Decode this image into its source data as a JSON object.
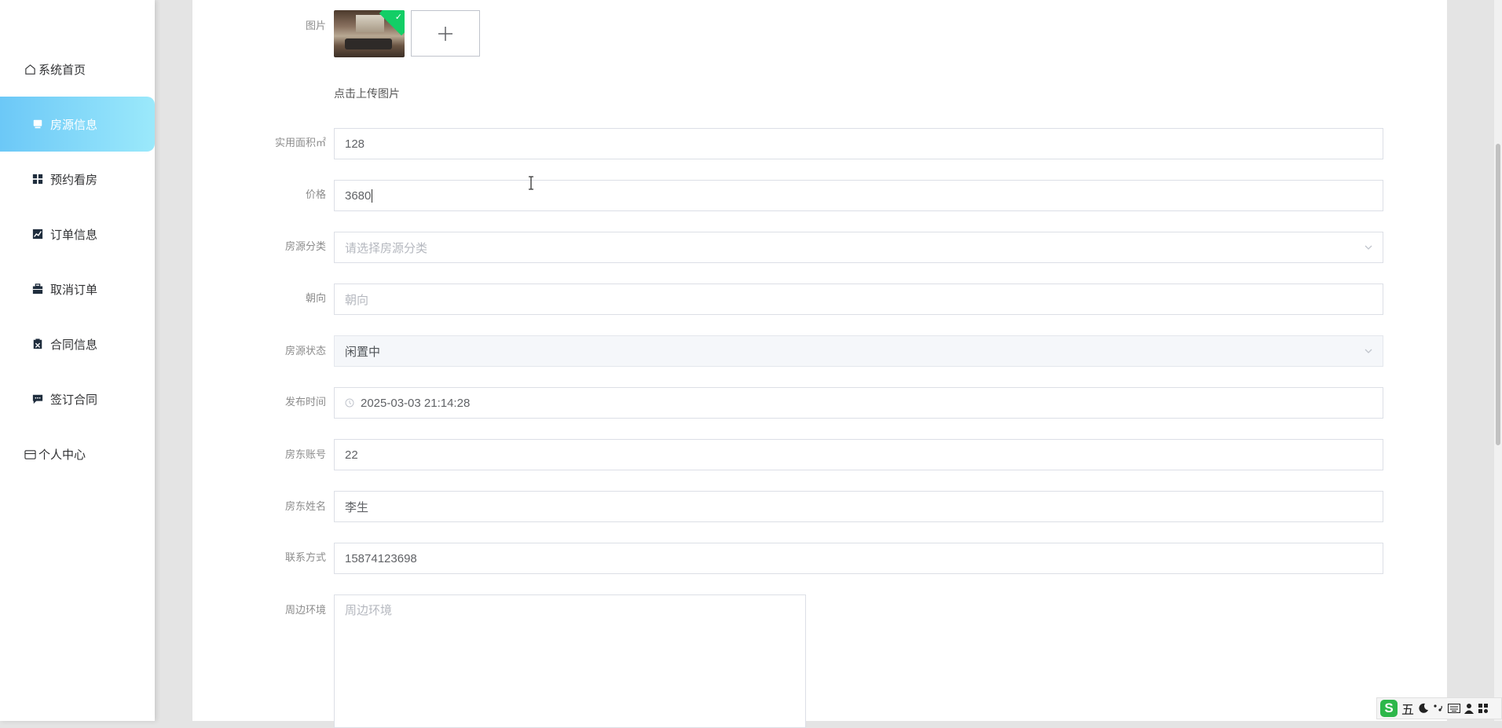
{
  "sidebar": {
    "items": [
      {
        "label": "系统首页",
        "icon": "home-icon"
      },
      {
        "label": "房源信息",
        "icon": "monitor-icon",
        "active": true
      },
      {
        "label": "预约看房",
        "icon": "grid-icon"
      },
      {
        "label": "订单信息",
        "icon": "chart-icon"
      },
      {
        "label": "取消订单",
        "icon": "briefcase-icon"
      },
      {
        "label": "合同信息",
        "icon": "clipboard-icon"
      },
      {
        "label": "签订合同",
        "icon": "chat-icon"
      },
      {
        "label": "个人中心",
        "icon": "card-icon"
      }
    ]
  },
  "form": {
    "image": {
      "label": "图片",
      "upload_hint": "点击上传图片",
      "add_symbol": "+"
    },
    "area": {
      "label": "实用面积㎡",
      "value": "128"
    },
    "price": {
      "label": "价格",
      "value": "3680"
    },
    "category": {
      "label": "房源分类",
      "placeholder": "请选择房源分类"
    },
    "orientation": {
      "label": "朝向",
      "placeholder": "朝向"
    },
    "status": {
      "label": "房源状态",
      "value": "闲置中"
    },
    "publish_time": {
      "label": "发布时间",
      "value": "2025-03-03 21:14:28"
    },
    "landlord_account": {
      "label": "房东账号",
      "value": "22"
    },
    "landlord_name": {
      "label": "房东姓名",
      "value": "李生"
    },
    "contact": {
      "label": "联系方式",
      "value": "15874123698"
    },
    "surroundings": {
      "label": "周边环境",
      "placeholder": "周边环境"
    }
  },
  "ime": {
    "logo": "S",
    "mode": "五"
  },
  "colors": {
    "accent_start": "#6cc8f7",
    "accent_end": "#9be9fb",
    "upload_success": "#13ce66"
  }
}
